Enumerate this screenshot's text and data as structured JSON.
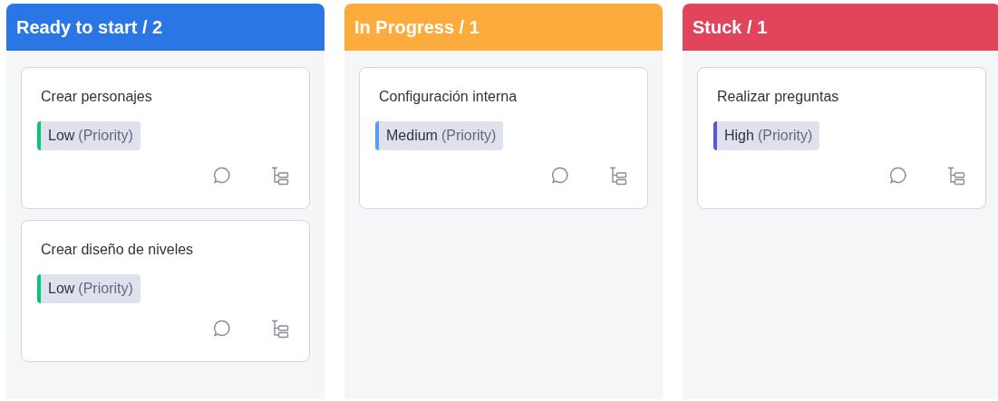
{
  "columns": [
    {
      "title": "Ready to start / 2",
      "color": "#2b76e5",
      "cards": [
        {
          "title": "Crear personajes",
          "priority": "Low",
          "priority_suffix": "(Priority)",
          "color": "#00c875"
        },
        {
          "title": "Crear diseño de niveles",
          "priority": "Low",
          "priority_suffix": "(Priority)",
          "color": "#00c875"
        }
      ]
    },
    {
      "title": "In Progress / 1",
      "color": "#fdab3d",
      "cards": [
        {
          "title": "Configuración interna",
          "priority": "Medium",
          "priority_suffix": "(Priority)",
          "color": "#579bfc"
        }
      ]
    },
    {
      "title": "Stuck / 1",
      "color": "#e2445c",
      "cards": [
        {
          "title": "Realizar preguntas",
          "priority": "High",
          "priority_suffix": "(Priority)",
          "color": "#5559df"
        }
      ]
    }
  ]
}
